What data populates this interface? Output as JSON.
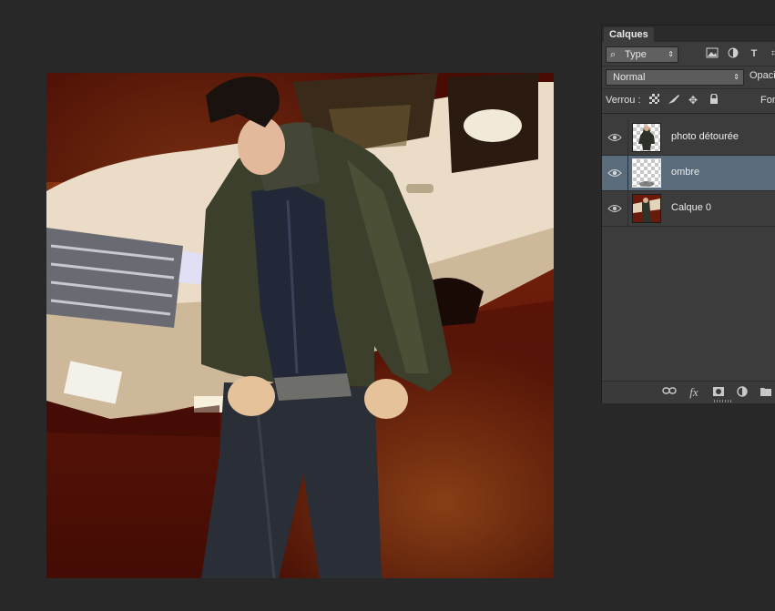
{
  "layers_panel": {
    "tab_label": "Calques",
    "filter": {
      "label": "Type",
      "icon": "search-icon"
    },
    "filter_icons": [
      "image-filter-icon",
      "adjustment-filter-icon",
      "type-filter-icon",
      "shape-filter-icon"
    ],
    "blend_mode": "Normal",
    "opacity_label": "Opacité :",
    "lock_label": "Verrou :",
    "lock_icons": [
      "lock-transparent-pixels-icon",
      "lock-image-pixels-icon",
      "lock-position-icon",
      "lock-all-icon"
    ],
    "fill_label": "Fond :",
    "layers": [
      {
        "name": "photo détourée",
        "visible": true,
        "selected": false
      },
      {
        "name": "ombre",
        "visible": true,
        "selected": true
      },
      {
        "name": "Calque 0",
        "visible": true,
        "selected": false
      }
    ],
    "bottom_icons": [
      "link-layers-icon",
      "fx-icon",
      "layer-mask-icon",
      "adjustment-layer-icon",
      "new-group-icon"
    ],
    "fx_label": "fx"
  },
  "colors": {
    "app_background": "#282828",
    "panel_background": "#3c3c3c",
    "selected_layer": "#5a6b7c"
  }
}
